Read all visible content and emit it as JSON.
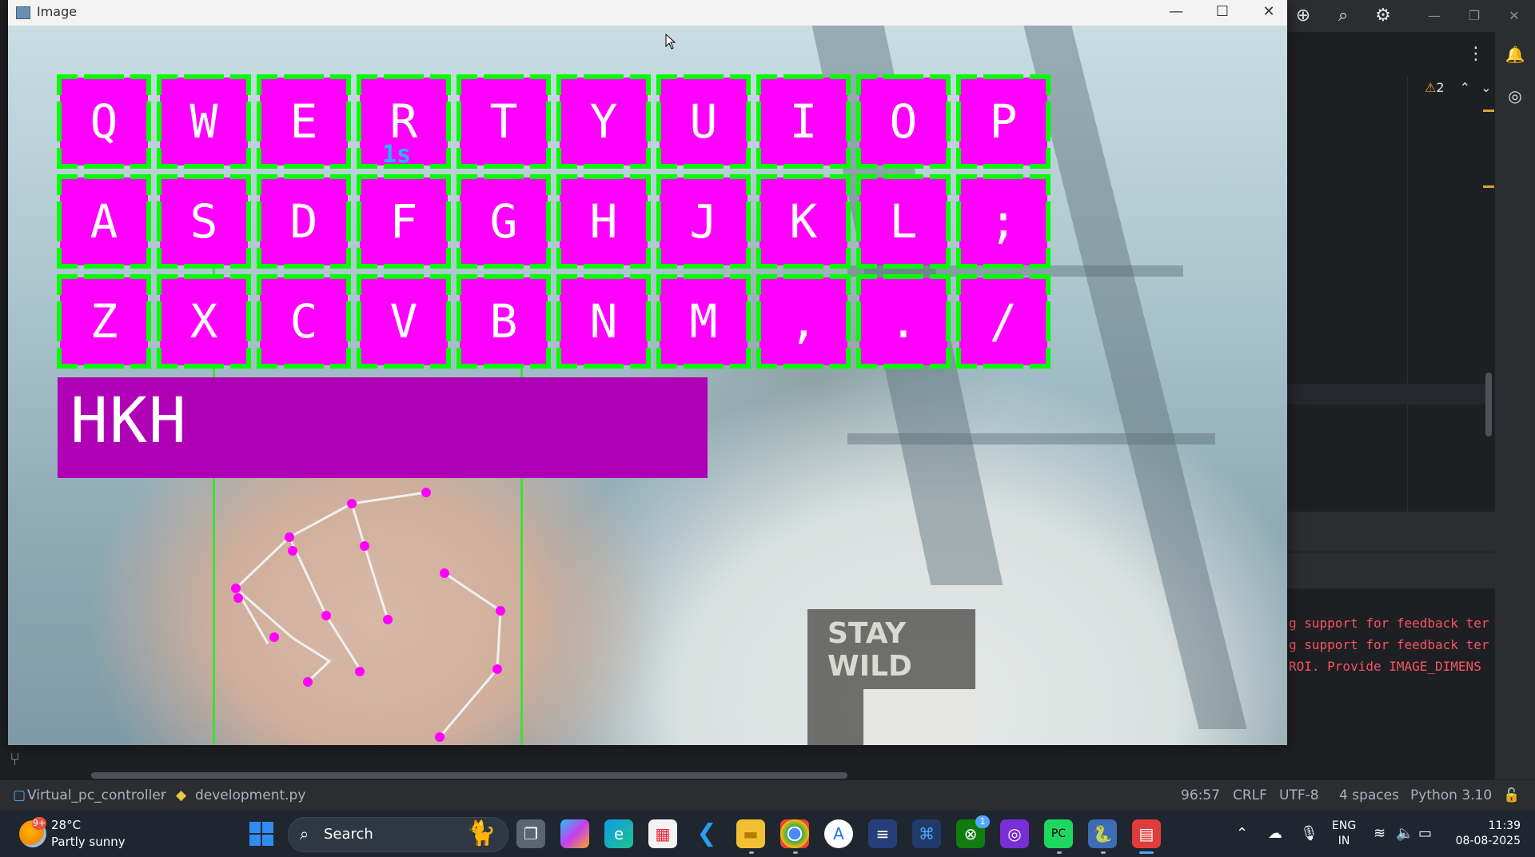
{
  "window": {
    "title": "Image",
    "icon": "image-window-icon"
  },
  "keyboard": {
    "rows": [
      [
        "Q",
        "W",
        "E",
        "R",
        "T",
        "Y",
        "U",
        "I",
        "O",
        "P"
      ],
      [
        "A",
        "S",
        "D",
        "F",
        "G",
        "H",
        "J",
        "K",
        "L",
        ";"
      ],
      [
        "Z",
        "X",
        "C",
        "V",
        "B",
        "N",
        "M",
        ",",
        ".",
        "/"
      ]
    ],
    "key_color": "#ff00ff",
    "border_color": "#00ff00",
    "hover_timer": "1s",
    "typed_text": "HKH",
    "text_box_color": "#b000b6"
  },
  "camera": {
    "shirt_print_text": "STAY WILD"
  },
  "ide": {
    "warning_count": "2",
    "terminal_lines": [
      "g support for feedback ter",
      "g support for feedback ter",
      " ROI. Provide IMAGE_DIMENS"
    ],
    "breadcrumb": {
      "project": "Virtual_pc_controller",
      "file": "development.py"
    },
    "status": {
      "position": "96:57",
      "line_ending": "CRLF",
      "encoding": "UTF-8",
      "indent": "4 spaces",
      "interpreter": "Python 3.10"
    }
  },
  "taskbar": {
    "weather_temp": "28°C",
    "weather_desc": "Partly sunny",
    "weather_badge": "9+",
    "search_label": "Search",
    "language_top": "ENG",
    "language_bottom": "IN",
    "time": "11:39",
    "date": "08-08-2025",
    "xbox_badge": "1"
  }
}
